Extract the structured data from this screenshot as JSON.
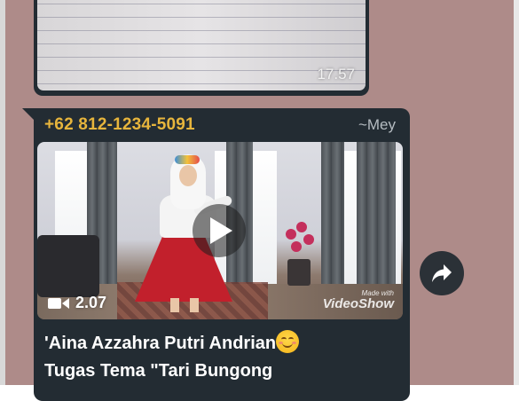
{
  "previous_message": {
    "time": "17.57"
  },
  "message": {
    "sender_phone": "+62 812-1234-5091",
    "sender_name": "~Mey",
    "video": {
      "duration": "2.07",
      "watermark_top": "Made with",
      "watermark_main": "VideoShow"
    },
    "caption_line1": "'Aina Azzahra Putri Andrian",
    "caption_emoji": "smiling-face-emoji",
    "caption_line2": "Tugas Tema \"Tari Bungong"
  },
  "icons": {
    "play": "play-icon",
    "video_camera": "video-camera-icon",
    "forward": "forward-icon"
  },
  "colors": {
    "chat_background": "#ae8b89",
    "bubble": "#232c33",
    "sender_name_color": "#e7b53c",
    "text": "#ffffff"
  }
}
